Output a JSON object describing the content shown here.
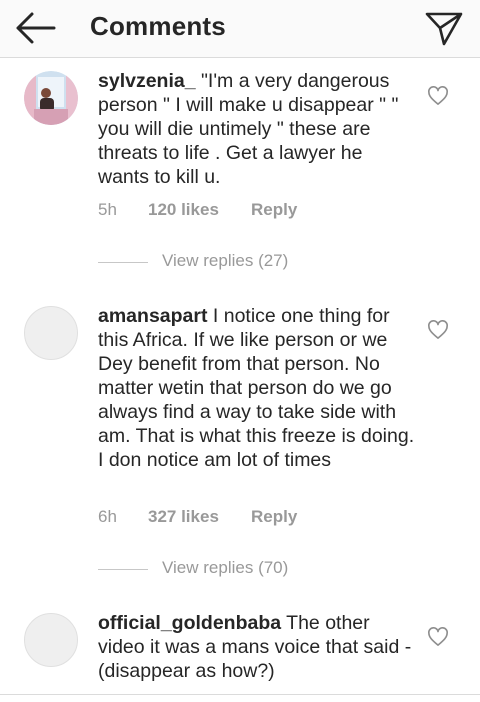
{
  "header": {
    "title": "Comments",
    "back_icon": "arrow-left-icon",
    "send_icon": "paper-plane-icon"
  },
  "comments": [
    {
      "username": "sylvzenia_",
      "text": " \"I'm a very dangerous person \" I will make u disappear \" \" you will die untimely \" these are threats to life . Get a lawyer he wants to kill u.",
      "time": "5h",
      "likes": "120 likes",
      "reply": "Reply",
      "view_replies": "View replies (27)"
    },
    {
      "username": "amansapart",
      "text": " I notice one thing for this Africa. If we like person or we Dey benefit from that person. No matter wetin that person do we go always find a way to take side with am. That is what this freeze is doing. I don notice am lot of times",
      "time": "6h",
      "likes": "327 likes",
      "reply": "Reply",
      "view_replies": "View replies (70)"
    },
    {
      "username": "official_goldenbaba",
      "text": " The other video it was a mans voice that said -(disappear as how?)"
    }
  ],
  "colors": {
    "text": "#262626",
    "muted": "#999999",
    "divider": "#dbdbdb"
  }
}
